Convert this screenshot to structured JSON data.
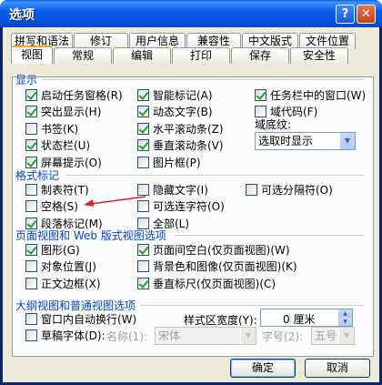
{
  "window": {
    "title": "选项",
    "help_glyph": "?",
    "close_glyph": "✕"
  },
  "tabs_row1": [
    "拼写和语法",
    "修订",
    "用户信息",
    "兼容性",
    "中文版式",
    "文件位置"
  ],
  "tabs_row2": [
    "视图",
    "常规",
    "编辑",
    "打印",
    "保存",
    "安全性"
  ],
  "active_tab": "视图",
  "sections": {
    "display": "显示",
    "format_marks": "格式标记",
    "print_web": "页面视图和 Web 版式视图选项",
    "outline": "大纲视图和普通视图选项"
  },
  "display_col1": [
    {
      "label": "启动任务窗格(R)",
      "checked": true
    },
    {
      "label": "突出显示(H)",
      "checked": true
    },
    {
      "label": "书签(K)",
      "checked": false
    },
    {
      "label": "状态栏(U)",
      "checked": true
    },
    {
      "label": "屏幕提示(O)",
      "checked": true
    }
  ],
  "display_col2": [
    {
      "label": "智能标记(A)",
      "checked": true
    },
    {
      "label": "动态文字(B)",
      "checked": true
    },
    {
      "label": "水平滚动条(Z)",
      "checked": true
    },
    {
      "label": "垂直滚动条(V)",
      "checked": true
    },
    {
      "label": "图片框(P)",
      "checked": false
    }
  ],
  "display_col3": [
    {
      "label": "任务栏中的窗口(W)",
      "checked": true
    },
    {
      "label": "域代码(F)",
      "checked": false
    }
  ],
  "field_shading": {
    "label": "域底纹:",
    "value": "选取时显示"
  },
  "marks_col1": [
    {
      "label": "制表符(T)",
      "checked": false
    },
    {
      "label": "空格(S)",
      "checked": false
    },
    {
      "label": "段落标记(M)",
      "checked": true
    }
  ],
  "marks_col2": [
    {
      "label": "隐藏文字(I)",
      "checked": false
    },
    {
      "label": "可选连字符(O)",
      "checked": false
    },
    {
      "label": "全部(L)",
      "checked": false
    }
  ],
  "marks_col3": [
    {
      "label": "可选分隔符(O)",
      "checked": false
    }
  ],
  "web_col1": [
    {
      "label": "图形(G)",
      "checked": true
    },
    {
      "label": "对象位置(J)",
      "checked": false
    },
    {
      "label": "正文边框(X)",
      "checked": false
    }
  ],
  "web_col2": [
    {
      "label": "页面间空白(仅页面视图)(W)",
      "checked": true
    },
    {
      "label": "背景色和图像(仅页面视图)(K)",
      "checked": false
    },
    {
      "label": "垂直标尺(仅页面视图)(C)",
      "checked": true
    }
  ],
  "outline_col1": [
    {
      "label": "窗口内自动换行(W)",
      "checked": false
    },
    {
      "label": "草稿字体(D):",
      "checked": false
    }
  ],
  "style_width": {
    "label": "样式区宽度(Y):",
    "value": "0 厘米"
  },
  "font_name": {
    "label": "名称(1):",
    "value": "宋体"
  },
  "font_size": {
    "label": "字号(2):",
    "value": "五号"
  },
  "buttons": {
    "ok": "确定",
    "cancel": "取消"
  },
  "colors": {
    "titlebar": "#0a5fe7",
    "section": "#0046d5",
    "annotation_arrow": "#e02020"
  }
}
